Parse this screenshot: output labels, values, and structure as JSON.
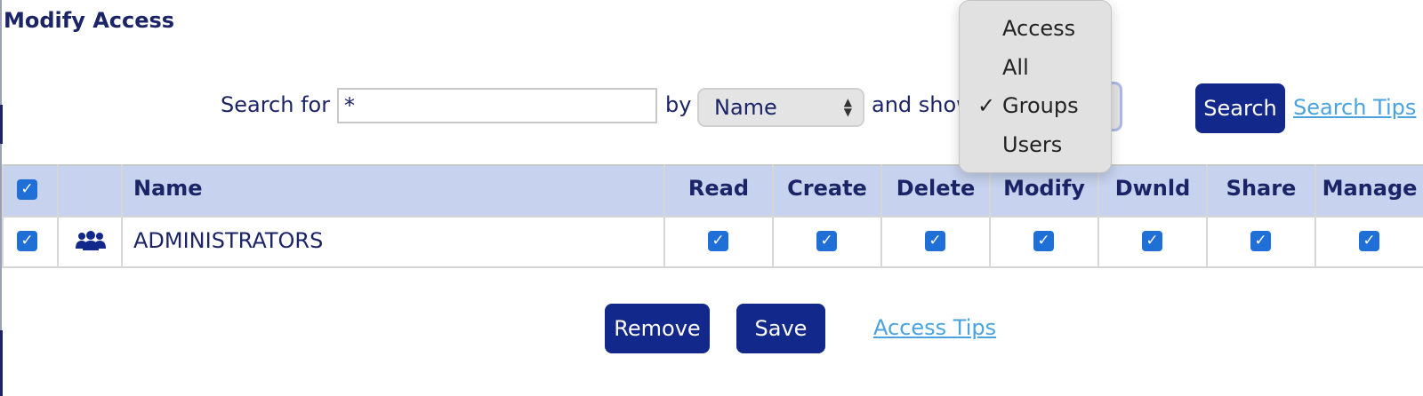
{
  "page": {
    "title": "Modify Access"
  },
  "search": {
    "label": "Search for",
    "value": "*",
    "by_label": "by",
    "by_selected": "Name",
    "show_label": "and show",
    "show_selected": "Groups",
    "show_options": [
      "Access",
      "All",
      "Groups",
      "Users"
    ],
    "button": "Search",
    "tips_link": "Search Tips"
  },
  "icons": {
    "checkbox": "check-mark-icon",
    "entry_type": "group-icon",
    "select": "updown-arrows-icon"
  },
  "table": {
    "columns": [
      "Name",
      "Read",
      "Create",
      "Delete",
      "Modify",
      "Dwnld",
      "Share",
      "Manage"
    ],
    "select_all_checked": true,
    "rows": [
      {
        "selected": true,
        "type": "group",
        "name": "ADMINISTRATORS",
        "read": true,
        "create": true,
        "delete": true,
        "modify": true,
        "dwnld": true,
        "share": true,
        "manage": true
      }
    ]
  },
  "actions": {
    "remove": "Remove",
    "save": "Save",
    "tips_link": "Access Tips"
  },
  "colors": {
    "primary": "#12288a",
    "header_bg": "#c6d2ee",
    "checkbox": "#1f6fd6",
    "link": "#4aa3df",
    "text": "#1b2466"
  }
}
